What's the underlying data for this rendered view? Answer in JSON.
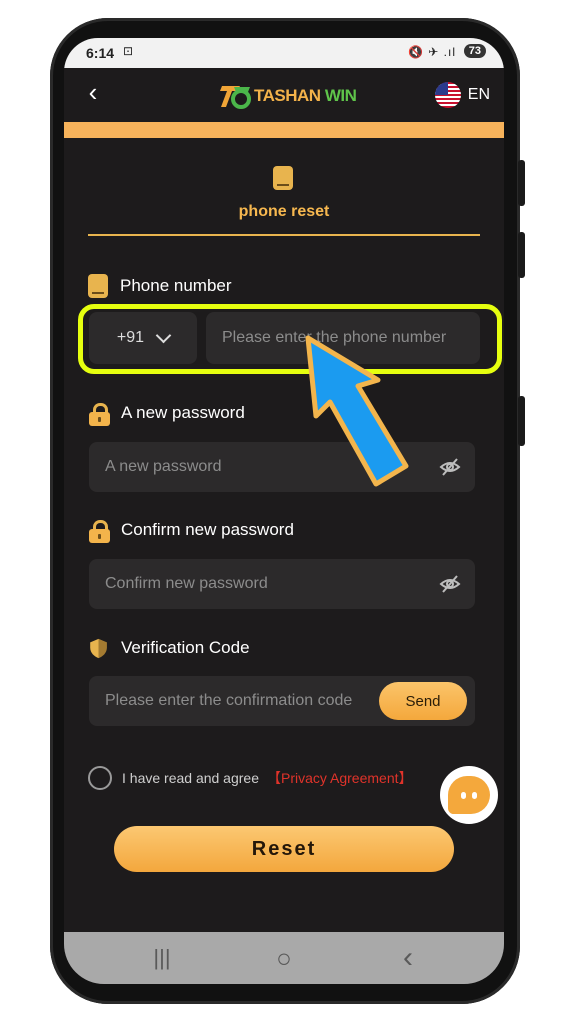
{
  "status_bar": {
    "time": "6:14",
    "battery": "73",
    "signal_icons": "🔇 ✈ .ıl"
  },
  "header": {
    "back_icon": "‹",
    "brand": "TASHAN",
    "brand_accent": "WIN",
    "language": "EN"
  },
  "tab": {
    "label": "phone reset"
  },
  "form": {
    "phone": {
      "label": "Phone number",
      "country_code": "+91",
      "placeholder": "Please enter the phone number"
    },
    "new_password": {
      "label": "A new password",
      "placeholder": "A new password"
    },
    "confirm_password": {
      "label": "Confirm new password",
      "placeholder": "Confirm new password"
    },
    "verification": {
      "label": "Verification Code",
      "placeholder": "Please enter the confirmation code",
      "send_label": "Send"
    },
    "agree_text": "I have read and agree",
    "privacy_link": "【Privacy Agreement】",
    "reset_label": "Reset"
  },
  "colors": {
    "accent": "#f7b84f",
    "background": "#1d1b1c",
    "input_bg": "#2c2a2b",
    "highlight": "#e6ff0f",
    "arrow": "#1b9bf0",
    "privacy": "#e0332a"
  },
  "nav": {
    "recent": "|||",
    "home": "○",
    "back": "‹"
  }
}
